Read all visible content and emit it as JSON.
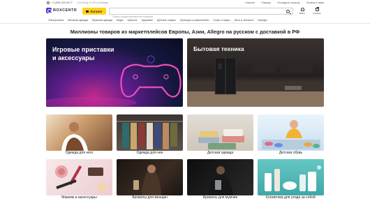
{
  "topbar": {
    "phone": "+7 (499) 325-08-77",
    "hours": "с 10:00 до 21:00 по Москве",
    "links": [
      "Новости",
      "Помощь",
      "Отследить посылку",
      "Оплата и заказ"
    ]
  },
  "header": {
    "logo": "BOXCENTR",
    "catalog_label": "Каталог",
    "search_placeholder": "Поиск среди миллионов товаров",
    "login_label": "Войти",
    "cart_label": "Корзина"
  },
  "nav": {
    "items": [
      "Электроника",
      "Женская одежда",
      "Мужская одежда",
      "Моды",
      "Красота",
      "Здоровье",
      "Детские товары",
      "Культура и развлечения",
      "Спорт и отдых",
      "Авто и запчасти",
      "Бренды"
    ]
  },
  "headline": "Миллионы товаров из маркетплейсов Европы, Азии, Allegro на русском с доставкой в РФ",
  "banners": [
    {
      "title": "Игровые приставки\nи аксессуары"
    },
    {
      "title": "Бытовая техника"
    }
  ],
  "categories": [
    {
      "label": "Одежда для него"
    },
    {
      "label": "Одежда для нее"
    },
    {
      "label": "Детская одежда"
    },
    {
      "label": "Детская обувь"
    },
    {
      "label": "Макияж и аксессуары"
    },
    {
      "label": "Ароматы для женщин"
    },
    {
      "label": "Ароматы для мужчин"
    },
    {
      "label": "Косметика для ухода за собой"
    }
  ],
  "colors": {
    "brand": "#5b34c6",
    "catalog_button": "#ffd21c"
  },
  "icons": [
    "phone-icon",
    "logo-icon",
    "menu-icon",
    "search-icon",
    "user-icon",
    "cart-icon"
  ]
}
